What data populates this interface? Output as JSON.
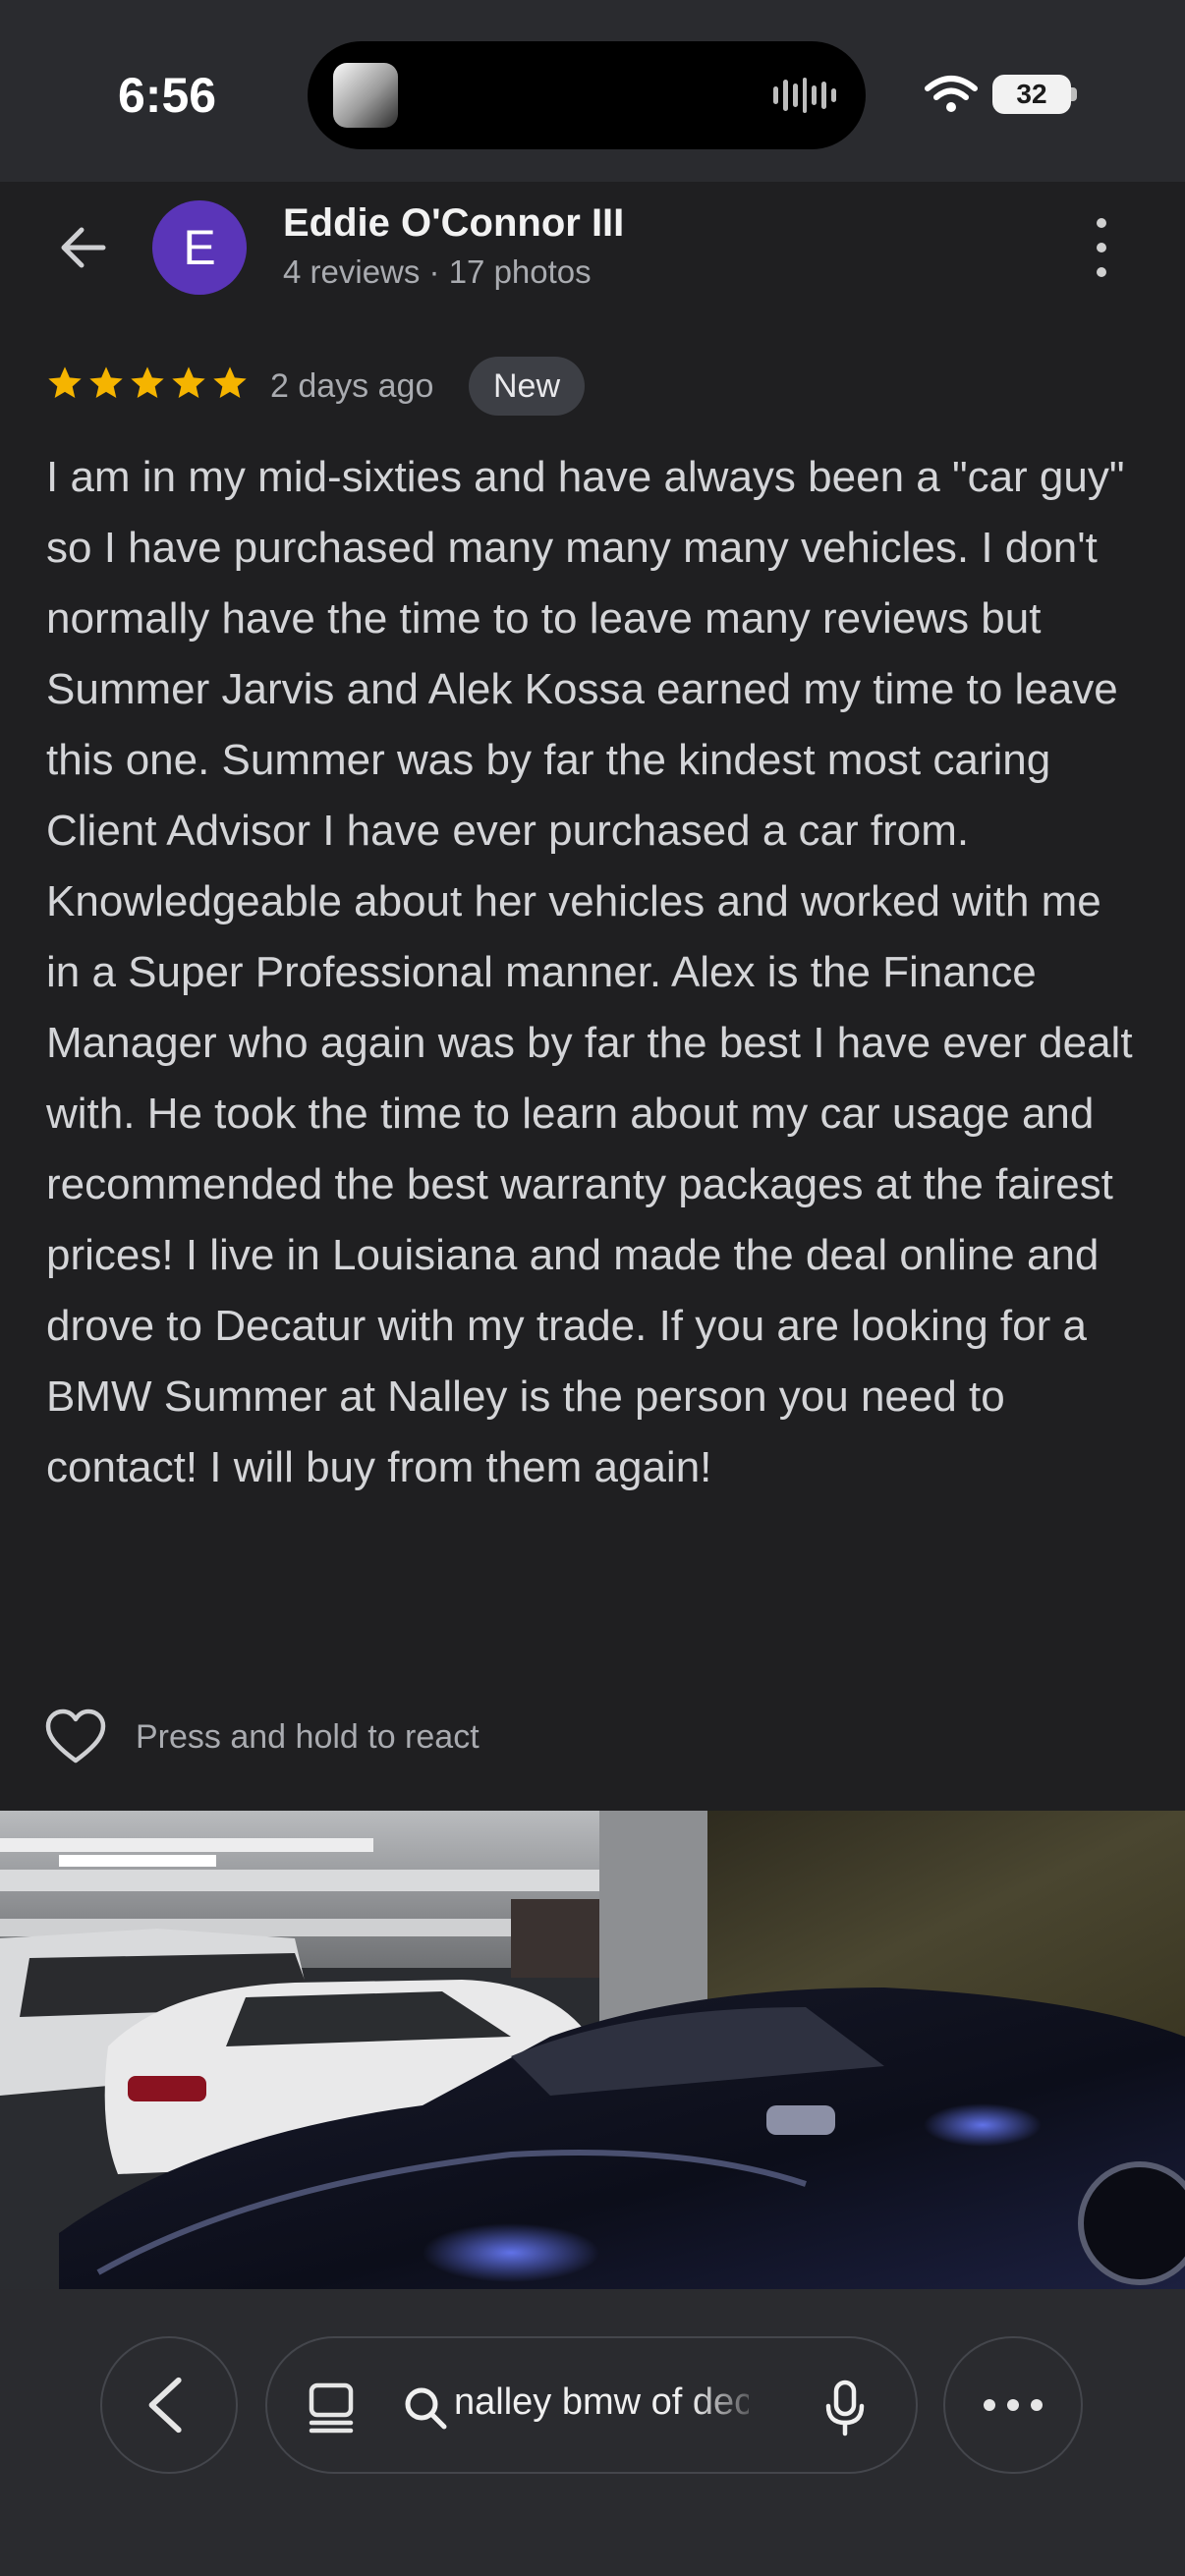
{
  "status_bar": {
    "time": "6:56",
    "battery": "32",
    "icons": [
      "wifi-icon",
      "battery-icon",
      "audio-wave-icon"
    ]
  },
  "reviewer": {
    "avatar_letter": "E",
    "avatar_color": "#5a35b8",
    "name": "Eddie O'Connor III",
    "meta": "4 reviews · 17 photos"
  },
  "review": {
    "rating": 5,
    "rating_max": 5,
    "star_color": "#f5b400",
    "date": "2 days ago",
    "badge": "New",
    "text": "I am in my mid-sixties and have always been a \"car guy\" so I have purchased many many many vehicles. I don't normally have the time to to leave many reviews but Summer Jarvis and Alek Kossa earned my time to leave this one. Summer was by far the kindest most caring Client Advisor I have ever purchased a car from. Knowledgeable about her vehicles and worked with me in a Super Professional manner. Alex is the Finance Manager who again was by far the best I have ever dealt with. He took the time to learn about my car usage and recommended the best warranty packages at the fairest prices! I live in Louisiana and made the deal online and drove to Decatur with my trade. If you are looking for a BMW Summer at Nalley is the person you need to contact! I will buy from them again!"
  },
  "reaction": {
    "label": "Press and hold to react"
  },
  "toolbar": {
    "url_text": "nalley bmw of decatur"
  }
}
